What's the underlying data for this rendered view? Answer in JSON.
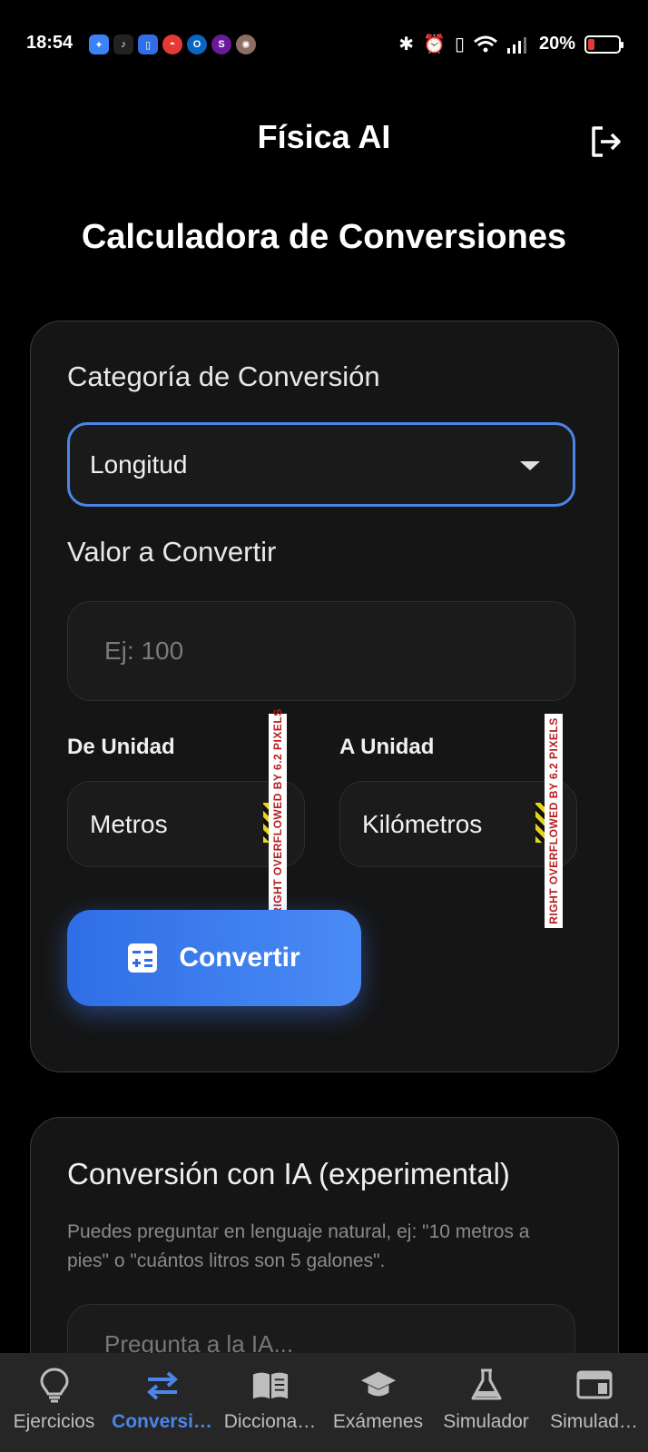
{
  "status_bar": {
    "time": "18:54",
    "battery": "20%",
    "battery_level": 0.2,
    "apps": [
      {
        "icon": "app-blue-icon",
        "color": "#3b82f6",
        "glyph": "✦"
      },
      {
        "icon": "tiktok-icon",
        "color": "#111111",
        "glyph": "♪"
      },
      {
        "icon": "app-phone-icon",
        "color": "#2f6ee6",
        "glyph": "▯"
      },
      {
        "icon": "pokeball-icon",
        "color": "#e53935",
        "glyph": "◓"
      },
      {
        "icon": "outlook-icon",
        "color": "#0a64c2",
        "glyph": "O"
      },
      {
        "icon": "snap-icon",
        "color": "#6a1b9a",
        "glyph": "S"
      },
      {
        "icon": "game-icon",
        "color": "#8d6e63",
        "glyph": "✺"
      }
    ]
  },
  "header": {
    "title": "Física AI",
    "logout_icon": "logout-icon"
  },
  "page": {
    "title": "Calculadora de Conversiones"
  },
  "converter": {
    "category_label": "Categoría de Conversión",
    "category_value": "Longitud",
    "value_label": "Valor a Convertir",
    "value_placeholder": "Ej: 100",
    "from_label": "De Unidad",
    "from_value": "Metros",
    "to_label": "A Unidad",
    "to_value": "Kilómetros",
    "overflow_text_from": "RIGHT OVERFLOWED BY 6.2 PIXELS",
    "overflow_text_to": "RIGHT OVERFLOWED BY 6.2 PIXELS",
    "convert_label": "Convertir"
  },
  "ai_conversion": {
    "title": "Conversión con IA (experimental)",
    "description": "Puedes preguntar en lenguaje natural, ej: \"10 metros a pies\" o \"cuántos litros son 5 galones\".",
    "input_placeholder": "Pregunta a la IA..."
  },
  "bottom_nav": {
    "items": [
      {
        "label": "Ejercicios",
        "icon": "lightbulb-icon"
      },
      {
        "label": "Conversi…",
        "icon": "swap-arrows-icon",
        "active": true
      },
      {
        "label": "Diccionа…",
        "icon": "book-icon"
      },
      {
        "label": "Exámenes",
        "icon": "graduation-cap-icon"
      },
      {
        "label": "Simulador",
        "icon": "flask-icon"
      },
      {
        "label": "Simulad…",
        "icon": "browser-window-icon"
      }
    ]
  },
  "colors": {
    "accent": "#4a86e8",
    "background": "#000000",
    "card": "#151515"
  }
}
